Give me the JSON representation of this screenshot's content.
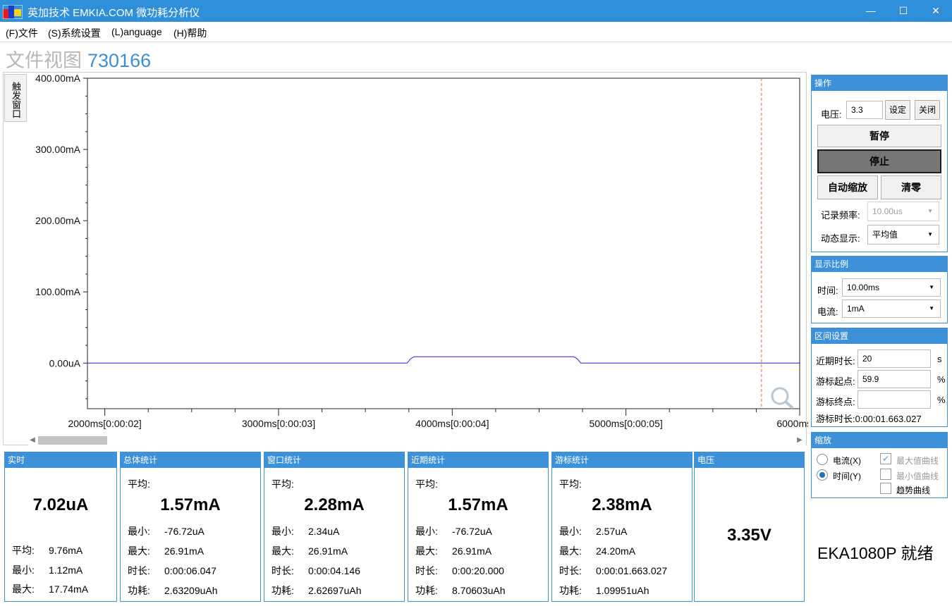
{
  "window": {
    "title": "英加技术 EMKIA.COM 微功耗分析仪",
    "min_icon": "minimize-icon",
    "max_icon": "maximize-icon",
    "close_icon": "close-icon"
  },
  "menu": [
    "(F)文件",
    "(S)系统设置",
    "(L)anguage",
    "(H)帮助"
  ],
  "view": {
    "label": "文件视图",
    "id": "730166"
  },
  "trigger_window_label": "触发窗口",
  "chart_data": {
    "type": "line",
    "title": "",
    "xlabel": "",
    "ylabel": "",
    "yticks": [
      "400.00mA",
      "300.00mA",
      "200.00mA",
      "100.00mA",
      "0.00uA"
    ],
    "xticks": [
      "2000ms[0:00:02]",
      "3000ms[0:00:03]",
      "4000ms[0:00:04]",
      "5000ms[0:00:05]",
      "6000ms[0:"
    ],
    "xlim": [
      1900,
      6000
    ],
    "ylim": [
      -64,
      400
    ],
    "cursor_x": 5780,
    "series": [
      {
        "color": "#1f1fd8",
        "x": [
          1900,
          3740,
          3760,
          3780,
          4700,
          4720,
          4740,
          6000
        ],
        "y": [
          0,
          0,
          6,
          9,
          9,
          6,
          0,
          0
        ]
      }
    ],
    "zoom_icon": "magnifier-icon"
  },
  "operations": {
    "header": "操作",
    "voltage_label": "电压:",
    "voltage_value": "3.3",
    "set_button": "设定",
    "off_button": "关闭",
    "pause_button": "暂停",
    "stop_button": "停止",
    "autoscale_button": "自动缩放",
    "zero_button": "清零",
    "rate_label": "记录频率:",
    "rate_value": "10.00us",
    "dynamic_label": "动态显示:",
    "dynamic_value": "平均值"
  },
  "scale": {
    "header": "显示比例",
    "time_label": "时间:",
    "time_value": "10.00ms",
    "current_label": "电流:",
    "current_value": "1mA"
  },
  "range": {
    "header": "区间设置",
    "recent_label": "近期时长:",
    "recent_value": "20",
    "recent_unit": "s",
    "cursor_start_label": "游标起点:",
    "cursor_start_value": "59.9",
    "cursor_start_unit": "%",
    "cursor_end_label": "游标终点:",
    "cursor_end_value": "",
    "cursor_end_unit": "%",
    "cursor_duration": "游标时长:0:00:01.663.027"
  },
  "zoom": {
    "header": "缩放",
    "current_x": "电流(X)",
    "time_y": "时间(Y)",
    "max_curve": "最大值曲线",
    "min_curve": "最小值曲线",
    "trend_curve": "趋势曲线"
  },
  "stats": {
    "realtime": {
      "header": "实时",
      "value": "7.02uA",
      "avg_k": "平均:",
      "avg": "9.76mA",
      "min_k": "最小:",
      "min": "1.12mA",
      "max_k": "最大:",
      "max": "17.74mA"
    },
    "total": {
      "header": "总体统计",
      "avg_k": "平均:",
      "value": "1.57mA",
      "min_k": "最小:",
      "min": "-76.72uA",
      "max_k": "最大:",
      "max": "26.91mA",
      "dur_k": "时长:",
      "dur": "0:00:06.047",
      "pow_k": "功耗:",
      "pow": "2.63209uAh"
    },
    "window": {
      "header": "窗口统计",
      "avg_k": "平均:",
      "value": "2.28mA",
      "min_k": "最小:",
      "min": "2.34uA",
      "max_k": "最大:",
      "max": "26.91mA",
      "dur_k": "时长:",
      "dur": "0:00:04.146",
      "pow_k": "功耗:",
      "pow": "2.62697uAh"
    },
    "recent": {
      "header": "近期统计",
      "avg_k": "平均:",
      "value": "1.57mA",
      "min_k": "最小:",
      "min": "-76.72uA",
      "max_k": "最大:",
      "max": "26.91mA",
      "dur_k": "时长:",
      "dur": "0:00:20.000",
      "pow_k": "功耗:",
      "pow": "8.70603uAh"
    },
    "cursor": {
      "header": "游标统计",
      "avg_k": "平均:",
      "value": "2.38mA",
      "min_k": "最小:",
      "min": "2.57uA",
      "max_k": "最大:",
      "max": "24.20mA",
      "dur_k": "时长:",
      "dur": "0:00:01.663.027",
      "pow_k": "功耗:",
      "pow": "1.09951uAh"
    },
    "voltage": {
      "header": "电压",
      "value": "3.35V"
    }
  },
  "status": "EKA1080P  就绪",
  "colors": {
    "accent": "#3d91d8",
    "title_bar": "#2f8fd8",
    "trace": "#1f1fd8",
    "cursor_line": "#e07050"
  }
}
